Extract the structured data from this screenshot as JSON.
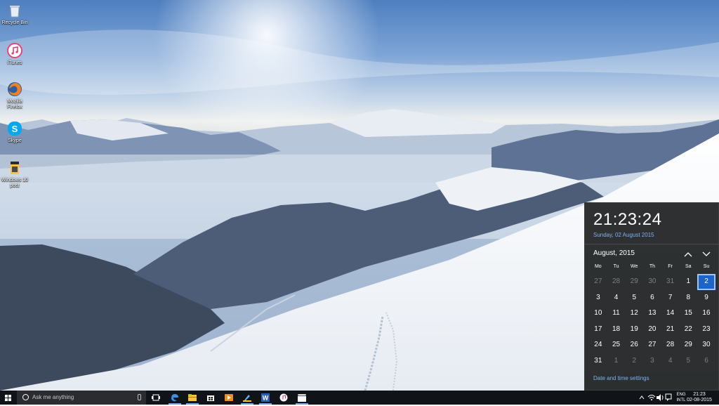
{
  "desktop_icons": [
    {
      "label": "Recycle Bin",
      "icon": "recycle-bin-icon"
    },
    {
      "label": "iTunes",
      "icon": "itunes-icon"
    },
    {
      "label": "Mozilla\nFirefox",
      "icon": "firefox-icon"
    },
    {
      "label": "Skype",
      "icon": "skype-icon"
    },
    {
      "label": "Windows 10\npost",
      "icon": "document-icon"
    }
  ],
  "taskbar": {
    "search_placeholder": "Ask me anything",
    "apps": [
      "task-view-icon",
      "edge-icon",
      "file-explorer-icon",
      "store-icon",
      "media-player-icon",
      "paint-icon",
      "word-icon",
      "itunes-icon",
      "movie-maker-icon"
    ],
    "language_top": "ENG",
    "language_bottom": "INTL",
    "clock_time": "21:23",
    "clock_date": "02-08-2015"
  },
  "calendar": {
    "time": "21:23:24",
    "date_long": "Sunday, 02 August 2015",
    "month_label": "August, 2015",
    "weekdays": [
      "Mo",
      "Tu",
      "We",
      "Th",
      "Fr",
      "Sa",
      "Su"
    ],
    "days": [
      {
        "d": "27",
        "dim": true
      },
      {
        "d": "28",
        "dim": true
      },
      {
        "d": "29",
        "dim": true
      },
      {
        "d": "30",
        "dim": true
      },
      {
        "d": "31",
        "dim": true
      },
      {
        "d": "1"
      },
      {
        "d": "2",
        "today": true
      },
      {
        "d": "3"
      },
      {
        "d": "4"
      },
      {
        "d": "5"
      },
      {
        "d": "6"
      },
      {
        "d": "7"
      },
      {
        "d": "8"
      },
      {
        "d": "9"
      },
      {
        "d": "10"
      },
      {
        "d": "11"
      },
      {
        "d": "12"
      },
      {
        "d": "13"
      },
      {
        "d": "14"
      },
      {
        "d": "15"
      },
      {
        "d": "16"
      },
      {
        "d": "17"
      },
      {
        "d": "18"
      },
      {
        "d": "19"
      },
      {
        "d": "20"
      },
      {
        "d": "21"
      },
      {
        "d": "22"
      },
      {
        "d": "23"
      },
      {
        "d": "24"
      },
      {
        "d": "25"
      },
      {
        "d": "26"
      },
      {
        "d": "27"
      },
      {
        "d": "28"
      },
      {
        "d": "29"
      },
      {
        "d": "30"
      },
      {
        "d": "31"
      },
      {
        "d": "1",
        "dim": true
      },
      {
        "d": "2",
        "dim": true
      },
      {
        "d": "3",
        "dim": true
      },
      {
        "d": "4",
        "dim": true
      },
      {
        "d": "5",
        "dim": true
      },
      {
        "d": "6",
        "dim": true
      }
    ],
    "settings_link": "Date and time settings",
    "accent": "#1c64c8",
    "link_color": "#7fb2ee"
  }
}
